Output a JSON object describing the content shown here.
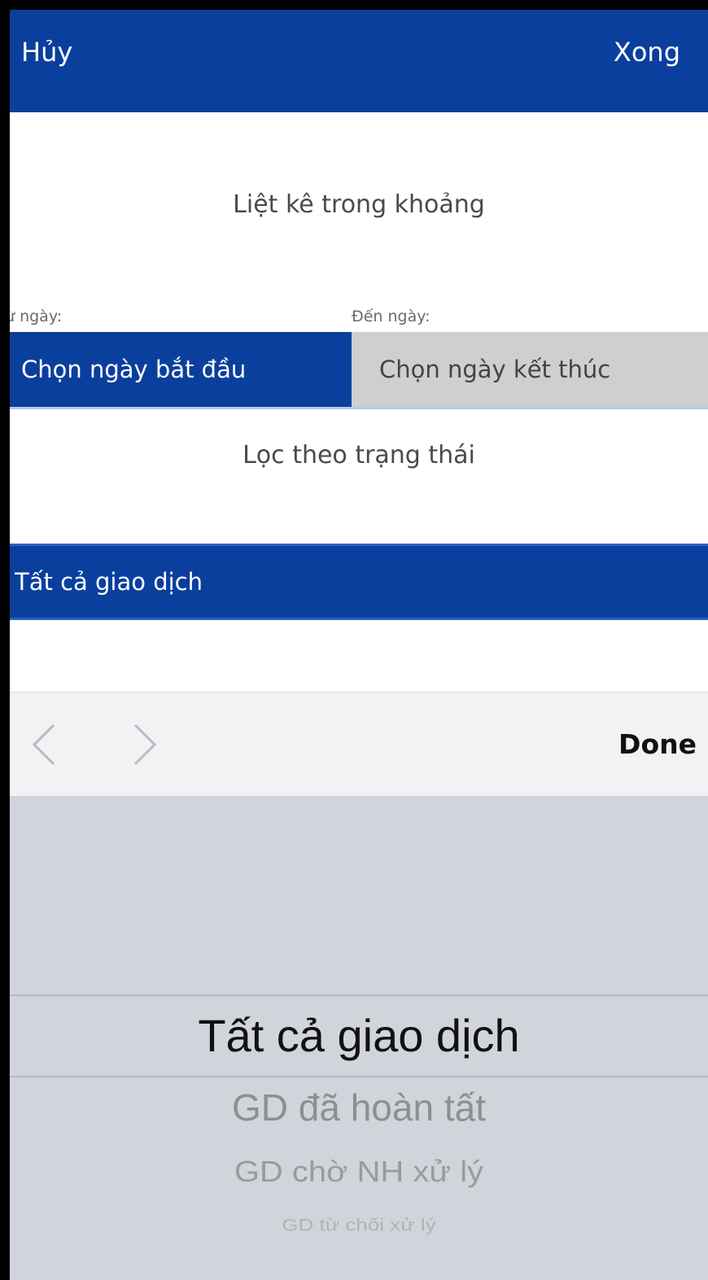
{
  "navbar": {
    "cancel_label": "Hủy",
    "done_label": "Xong"
  },
  "filters": {
    "range_title": "Liệt kê trong khoảng",
    "from_label": "ừ ngày:",
    "to_label": "Đến ngày:",
    "start_button": "Chọn ngày bắt đầu",
    "end_button": "Chọn ngày kết thúc",
    "status_title": "Lọc theo trạng thái",
    "status_value": "Tất cả giao dịch"
  },
  "keyboard_toolbar": {
    "prev_icon": "chevron-left-icon",
    "next_icon": "chevron-right-icon",
    "done_label": "Done"
  },
  "picker": {
    "options": [
      {
        "label": "Tất cả giao dịch"
      },
      {
        "label": "GD đã hoàn tất"
      },
      {
        "label": "GD chờ NH xử lý"
      },
      {
        "label": "GD từ chối xử lý"
      }
    ],
    "selected": "Tất cả giao dịch"
  },
  "colors": {
    "brand": "#0a3f9e",
    "inactive_button": "#cfcfcf",
    "picker_bg": "#d1d4da"
  }
}
